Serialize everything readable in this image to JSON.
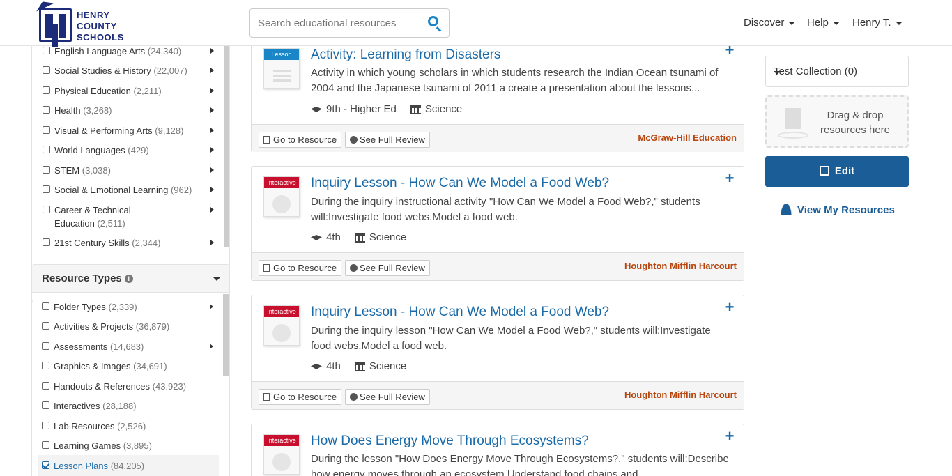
{
  "header": {
    "logo_lines": [
      "HENRY",
      "COUNTY",
      "SCHOOLS"
    ],
    "search_placeholder": "Search educational resources",
    "nav": [
      "Discover",
      "Help",
      "Henry T."
    ]
  },
  "subjects": [
    {
      "label": "English Language Arts",
      "count": "(24,340)",
      "expand": true
    },
    {
      "label": "Social Studies & History",
      "count": "(22,007)",
      "expand": true
    },
    {
      "label": "Physical Education",
      "count": "(2,211)",
      "expand": true
    },
    {
      "label": "Health",
      "count": "(3,268)",
      "expand": true
    },
    {
      "label": "Visual & Performing Arts",
      "count": "(9,128)",
      "expand": true
    },
    {
      "label": "World Languages",
      "count": "(429)",
      "expand": true
    },
    {
      "label": "STEM",
      "count": "(3,038)",
      "expand": true
    },
    {
      "label": "Social & Emotional Learning",
      "count": "(962)",
      "expand": true
    },
    {
      "label": "Career & Technical",
      "label2": "Education",
      "count": "(2,511)",
      "expand": true
    },
    {
      "label": "21st Century Skills",
      "count": "(2,344)",
      "expand": true
    }
  ],
  "resource_types": {
    "title": "Resource Types",
    "items": [
      {
        "label": "Folder Types",
        "count": "(2,339)",
        "expand": true,
        "checked": false
      },
      {
        "label": "Activities & Projects",
        "count": "(36,879)",
        "expand": false,
        "checked": false
      },
      {
        "label": "Assessments",
        "count": "(14,683)",
        "expand": true,
        "checked": false
      },
      {
        "label": "Graphics & Images",
        "count": "(34,691)",
        "expand": false,
        "checked": false
      },
      {
        "label": "Handouts & References",
        "count": "(43,923)",
        "expand": false,
        "checked": false
      },
      {
        "label": "Interactives",
        "count": "(28,188)",
        "expand": false,
        "checked": false
      },
      {
        "label": "Lab Resources",
        "count": "(2,526)",
        "expand": false,
        "checked": false
      },
      {
        "label": "Learning Games",
        "count": "(3,895)",
        "expand": false,
        "checked": false
      },
      {
        "label": "Lesson Plans",
        "count": "(84,205)",
        "expand": false,
        "checked": true
      }
    ]
  },
  "results": [
    {
      "tag": "Lesson",
      "title": "Activity: Learning from Disasters",
      "desc": "Activity in which young scholars in which students research the Indian Ocean tsunami of 2004 and the Japanese tsunami of 2011 a create a presentation about the lessons...",
      "grade": "9th - Higher Ed",
      "subject": "Science",
      "publisher": "McGraw-Hill Education"
    },
    {
      "tag": "Interactive",
      "title": "Inquiry Lesson - How Can We Model a Food Web?",
      "desc": "During the inquiry instructional activity \"How Can We Model a Food Web?,\" students will:Investigate food webs.Model a food web.",
      "grade": "4th",
      "subject": "Science",
      "publisher": "Houghton Mifflin Harcourt"
    },
    {
      "tag": "Interactive",
      "title": "Inquiry Lesson - How Can We Model a Food Web?",
      "desc": "During the inquiry lesson \"How Can We Model a Food Web?,\" students will:Investigate food webs.Model a food web.",
      "grade": "4th",
      "subject": "Science",
      "publisher": "Houghton Mifflin Harcourt"
    },
    {
      "tag": "Interactive",
      "title": "How Does Energy Move Through Ecosystems?",
      "desc": "During the lesson \"How Does Energy Move Through Ecosystems?,\" students will:Describe how energy moves through an ecosystem.Understand food chains and",
      "grade": "",
      "subject": "",
      "publisher": ""
    }
  ],
  "buttons": {
    "go_to_resource": "Go to Resource",
    "see_full_review": "See Full Review",
    "add": "+"
  },
  "right": {
    "collection": "Test Collection (0)",
    "drop_text": "Drag & drop resources here",
    "edit": "Edit",
    "view_mine": "View My Resources"
  },
  "colors": {
    "brand": "#1c2a7a",
    "link": "#1a6aa8",
    "primary_button": "#1b5d96",
    "publisher": "#b8450d",
    "lesson_tag": "#1a86c8",
    "interactive_tag": "#c8102e"
  }
}
